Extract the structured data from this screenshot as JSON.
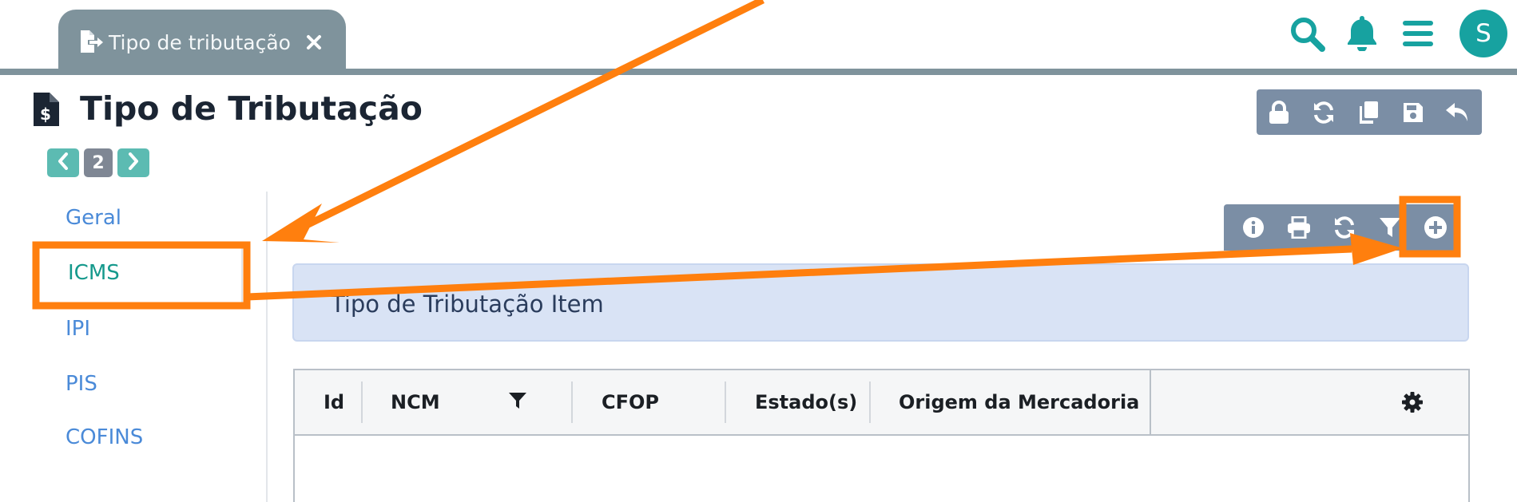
{
  "tab": {
    "label": "Tipo de tributação"
  },
  "header_icons": [
    "search-icon",
    "bell-icon",
    "hamburger-menu-icon"
  ],
  "user": {
    "initial": "S"
  },
  "page": {
    "title": "Tipo de Tributação"
  },
  "toolbar": {
    "icons": [
      "lock-icon",
      "refresh-icon",
      "copy-icon",
      "save-icon",
      "undo-icon"
    ]
  },
  "pager": {
    "current": "2"
  },
  "nav": {
    "items": [
      {
        "label": "Geral"
      },
      {
        "label": "ICMS"
      },
      {
        "label": "IPI"
      },
      {
        "label": "PIS"
      },
      {
        "label": "COFINS"
      }
    ],
    "active": "ICMS"
  },
  "sub_toolbar": {
    "icons": [
      "info-icon",
      "print-icon",
      "refresh-icon",
      "filter-icon",
      "add-circle-icon"
    ]
  },
  "section": {
    "title": "Tipo de Tributação Item"
  },
  "table": {
    "columns": [
      "Id",
      "NCM",
      "CFOP",
      "Estado(s)",
      "Origem da Mercadoria"
    ],
    "rows": []
  },
  "colors": {
    "tab_bg": "#7f939c",
    "accent_teal": "#17a2a0",
    "toolbar_bg": "#7b8ea5",
    "link_blue": "#4a8ad8",
    "active_green": "#15998c",
    "section_bg": "#d9e3f5",
    "annotation_orange": "#ff7f0e"
  }
}
